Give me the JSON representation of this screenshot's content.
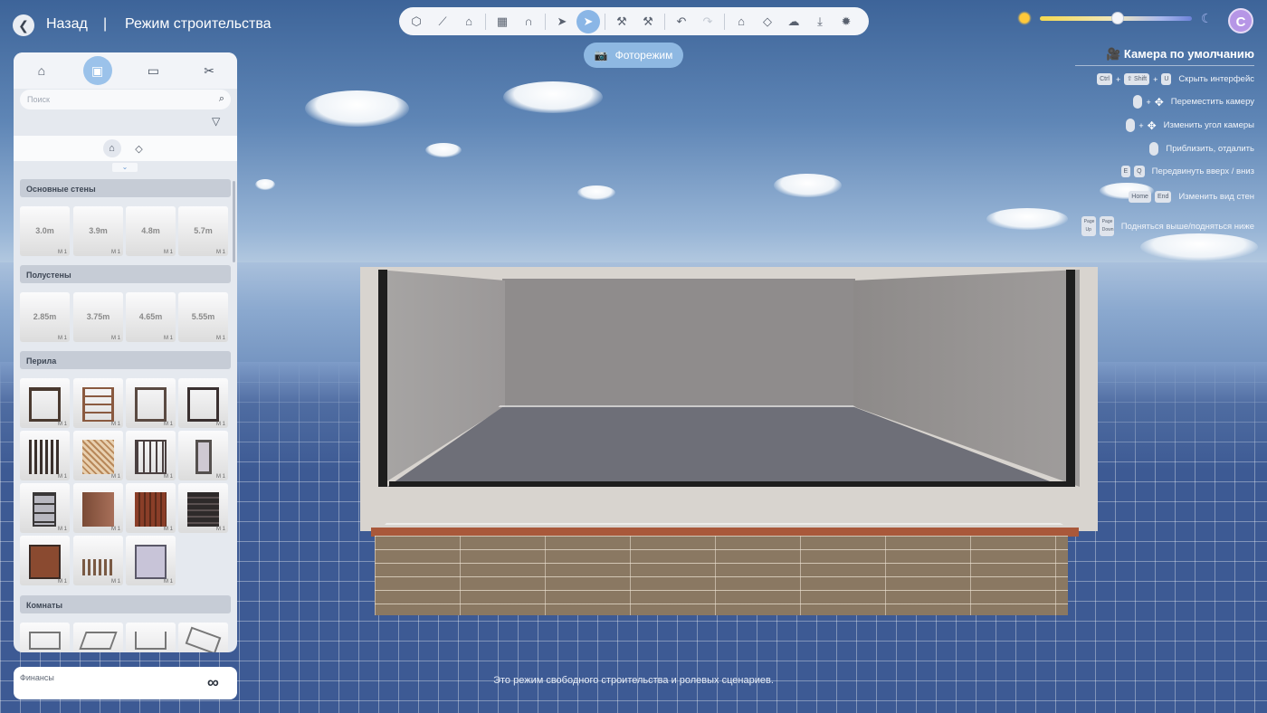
{
  "nav": {
    "back_label": "Назад",
    "separator": "|",
    "mode_title": "Режим строительства"
  },
  "toolbar": {
    "buttons": [
      "cube-icon",
      "measure-icon",
      "camera-place-icon",
      "grid-icon",
      "magnet-icon",
      "cursor-icon",
      "select-cursor-icon",
      "hammer-icon",
      "build-hammer-icon",
      "undo-icon",
      "redo-icon",
      "house-up-icon",
      "house-layers-icon",
      "house-cloud-icon",
      "download-icon",
      "bug-icon"
    ],
    "active": "select-cursor-icon"
  },
  "photo_mode": {
    "label": "Фоторежим"
  },
  "time_slider": {
    "value": 0.51
  },
  "avatar": {
    "letter": "C"
  },
  "camera": {
    "title": "Камера по умолчанию",
    "hints": [
      {
        "keys": [
          "Ctrl",
          "+",
          "⇧ Shift",
          "+",
          "U"
        ],
        "text": "Скрыть интерфейс"
      },
      {
        "keys": [
          "mouse-left",
          "+",
          "move-cross"
        ],
        "text": "Переместить камеру"
      },
      {
        "keys": [
          "mouse-right",
          "+",
          "move-cross"
        ],
        "text": "Изменить угол камеры"
      },
      {
        "keys": [
          "mouse-wheel"
        ],
        "text": "Приблизить, отдалить"
      },
      {
        "keys": [
          "E",
          "Q"
        ],
        "text": "Передвинуть вверх / вниз"
      },
      {
        "keys": [
          "Home",
          "End"
        ],
        "text": "Изменить вид стен"
      },
      {
        "keys": [
          "Page Up",
          "Page Down"
        ],
        "text": "Подняться выше/подняться ниже"
      }
    ]
  },
  "panel": {
    "tabs": [
      "house-icon",
      "walls-icon",
      "sofa-icon",
      "tools-icon"
    ],
    "active_tab": "walls-icon",
    "search_placeholder": "Поиск",
    "sections": [
      {
        "title": "Основные стены",
        "items": [
          "3.0m",
          "3.9m",
          "4.8m",
          "5.7m"
        ]
      },
      {
        "title": "Полустены",
        "items": [
          "2.85m",
          "3.75m",
          "4.65m",
          "5.55m"
        ]
      },
      {
        "title": "Перила",
        "items": [
          "",
          "",
          "",
          "",
          "",
          "",
          "",
          "",
          "",
          "",
          "",
          "",
          "",
          "",
          ""
        ]
      },
      {
        "title": "Комнаты",
        "items": [
          "",
          "",
          "",
          ""
        ]
      }
    ],
    "count_label": "M 1"
  },
  "finance": {
    "label": "Финансы",
    "value_icon": "infinity-icon"
  },
  "caption": "Это режим свободного строительства и ролевых сценариев."
}
